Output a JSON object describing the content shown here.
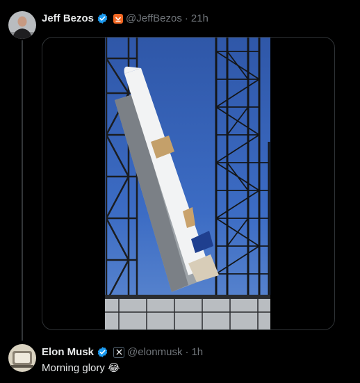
{
  "tweet": {
    "author": {
      "name": "Jeff Bezos",
      "handle": "@JeffBezos",
      "time": "21h",
      "separator": "·"
    }
  },
  "reply": {
    "author": {
      "name": "Elon Musk",
      "handle": "@elonmusk",
      "time": "1h",
      "separator": "·"
    },
    "text": "Morning glory",
    "emoji": "😂"
  },
  "icons": {
    "verified": "verified-badge-icon",
    "blue_origin": "blue-origin-affiliation-icon",
    "x_logo": "x-affiliation-icon"
  },
  "colors": {
    "verified_blue": "#1d9bf0",
    "blue_origin_orange": "#f26722",
    "secondary_text": "#71767b"
  }
}
